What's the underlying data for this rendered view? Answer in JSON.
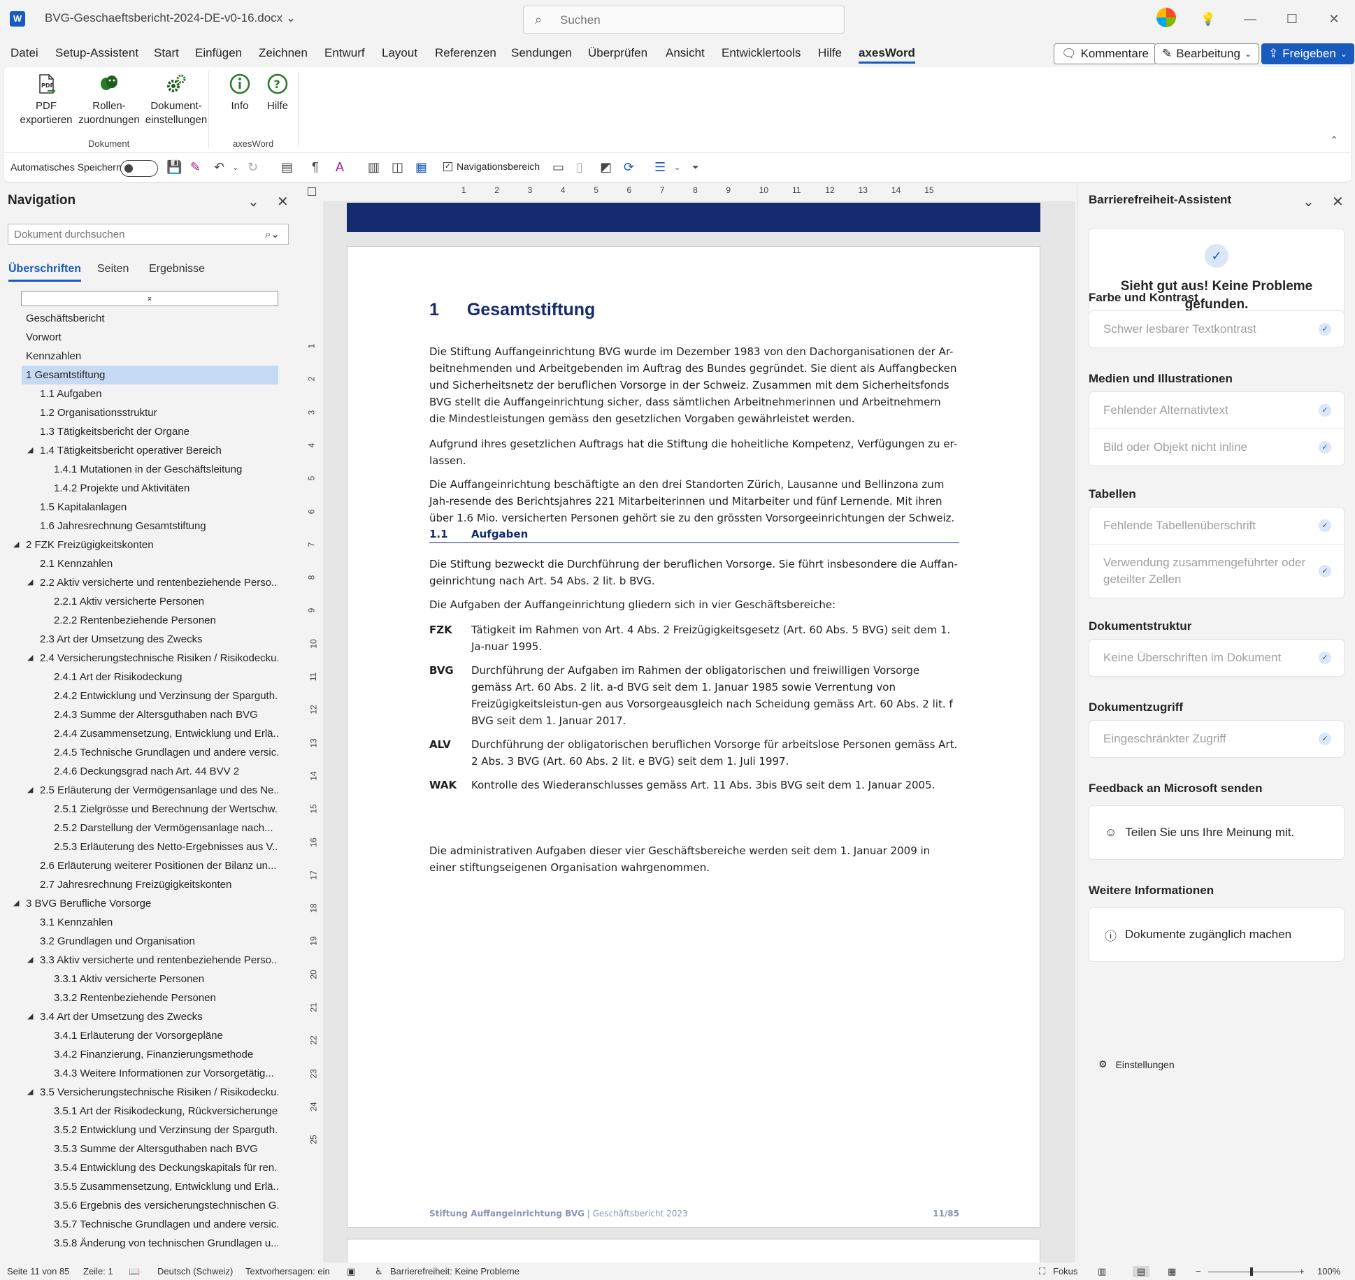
{
  "titlebar": {
    "doc_title": "BVG-Geschaeftsbericht-2024-DE-v0-16.docx",
    "title_chevron": "⌄",
    "search_placeholder": "Suchen",
    "app_icon_letter": "W"
  },
  "menu": {
    "items": [
      "Datei",
      "Setup-Assistent",
      "Start",
      "Einfügen",
      "Zeichnen",
      "Entwurf",
      "Layout",
      "Referenzen",
      "Sendungen",
      "Überprüfen",
      "Ansicht",
      "Entwicklertools",
      "Hilfe",
      "axesWord"
    ],
    "active": "axesWord",
    "comments_label": "Kommentare",
    "editing_label": "Bearbeitung",
    "share_label": "Freigeben"
  },
  "ribbon": {
    "group_document": "Dokument",
    "group_axesword": "axesWord",
    "pdf_line1": "PDF",
    "pdf_line2": "exportieren",
    "roles_line1": "Rollen-",
    "roles_line2": "zuordnungen",
    "docsettings_line1": "Dokument-",
    "docsettings_line2": "einstellungen",
    "info": "Info",
    "help": "Hilfe"
  },
  "qat": {
    "autosave_label": "Automatisches Speichern",
    "nav_pane_label": "Navigationsbereich"
  },
  "navigation": {
    "title": "Navigation",
    "search_placeholder": "Dokument durchsuchen",
    "tabs": [
      "Überschriften",
      "Seiten",
      "Ergebnisse"
    ],
    "active_tab": "Überschriften",
    "items": [
      {
        "level": 0,
        "text": "Geschäftsbericht",
        "expander": false
      },
      {
        "level": 0,
        "text": "Vorwort",
        "expander": false
      },
      {
        "level": 0,
        "text": "Kennzahlen",
        "expander": false
      },
      {
        "level": 0,
        "text": "1 Gesamtstiftung",
        "expander": true,
        "selected": true
      },
      {
        "level": 1,
        "text": "1.1 Aufgaben",
        "expander": false
      },
      {
        "level": 1,
        "text": "1.2 Organisationsstruktur",
        "expander": false
      },
      {
        "level": 1,
        "text": "1.3 Tätigkeitsbericht der Organe",
        "expander": false
      },
      {
        "level": 1,
        "text": "1.4 Tätigkeitsbericht operativer Bereich",
        "expander": true
      },
      {
        "level": 2,
        "text": "1.4.1 Mutationen in der Geschäftsleitung",
        "expander": false
      },
      {
        "level": 2,
        "text": "1.4.2 Projekte und Aktivitäten",
        "expander": false
      },
      {
        "level": 1,
        "text": "1.5 Kapitalanlagen",
        "expander": false
      },
      {
        "level": 1,
        "text": "1.6 Jahresrechnung Gesamtstiftung",
        "expander": false
      },
      {
        "level": 0,
        "text": "2 FZK Freizügigkeitskonten",
        "expander": true
      },
      {
        "level": 1,
        "text": "2.1 Kennzahlen",
        "expander": false
      },
      {
        "level": 1,
        "text": "2.2 Aktiv versicherte und rentenbeziehende Perso...",
        "expander": true
      },
      {
        "level": 2,
        "text": "2.2.1 Aktiv versicherte Personen",
        "expander": false
      },
      {
        "level": 2,
        "text": "2.2.2 Rentenbeziehende Personen",
        "expander": false
      },
      {
        "level": 1,
        "text": "2.3 Art der Umsetzung des Zwecks",
        "expander": false
      },
      {
        "level": 1,
        "text": "2.4 Versicherungstechnische Risiken / Risikodecku...",
        "expander": true
      },
      {
        "level": 2,
        "text": "2.4.1 Art der Risikodeckung",
        "expander": false
      },
      {
        "level": 2,
        "text": "2.4.2 Entwicklung und Verzinsung der Sparguth...",
        "expander": false
      },
      {
        "level": 2,
        "text": "2.4.3 Summe der Altersguthaben nach BVG",
        "expander": false
      },
      {
        "level": 2,
        "text": "2.4.4 Zusammensetzung, Entwicklung und Erlä...",
        "expander": false
      },
      {
        "level": 2,
        "text": "2.4.5 Technische Grundlagen und andere versic...",
        "expander": false
      },
      {
        "level": 2,
        "text": "2.4.6 Deckungsgrad nach Art. 44 BVV 2",
        "expander": false
      },
      {
        "level": 1,
        "text": "2.5 Erläuterung der Vermögensanlage und des Ne...",
        "expander": true
      },
      {
        "level": 2,
        "text": "2.5.1 Zielgrösse und Berechnung der Wertschw...",
        "expander": false
      },
      {
        "level": 2,
        "text": "2.5.2 Darstellung der Vermögensanlage nach...",
        "expander": false
      },
      {
        "level": 2,
        "text": "2.5.3 Erläuterung des Netto-Ergebnisses aus V...",
        "expander": false
      },
      {
        "level": 1,
        "text": "2.6 Erläuterung weiterer Positionen der Bilanz un...",
        "expander": false
      },
      {
        "level": 1,
        "text": "2.7 Jahresrechnung Freizügigkeitskonten",
        "expander": false
      },
      {
        "level": 0,
        "text": "3 BVG Berufliche Vorsorge",
        "expander": true
      },
      {
        "level": 1,
        "text": "3.1 Kennzahlen",
        "expander": false
      },
      {
        "level": 1,
        "text": "3.2 Grundlagen und Organisation",
        "expander": false
      },
      {
        "level": 1,
        "text": "3.3 Aktiv versicherte und rentenbeziehende Perso...",
        "expander": true
      },
      {
        "level": 2,
        "text": "3.3.1 Aktiv versicherte Personen",
        "expander": false
      },
      {
        "level": 2,
        "text": "3.3.2 Rentenbeziehende Personen",
        "expander": false
      },
      {
        "level": 1,
        "text": "3.4 Art der Umsetzung des Zwecks",
        "expander": true
      },
      {
        "level": 2,
        "text": "3.4.1 Erläuterung der Vorsorgepläne",
        "expander": false
      },
      {
        "level": 2,
        "text": "3.4.2 Finanzierung, Finanzierungsmethode",
        "expander": false
      },
      {
        "level": 2,
        "text": "3.4.3 Weitere Informationen zur Vorsorgetätig...",
        "expander": false
      },
      {
        "level": 1,
        "text": "3.5 Versicherungstechnische Risiken / Risikodecku...",
        "expander": true
      },
      {
        "level": 2,
        "text": "3.5.1 Art der Risikodeckung, Rückversicherungen",
        "expander": false
      },
      {
        "level": 2,
        "text": "3.5.2 Entwicklung und Verzinsung der Sparguth...",
        "expander": false
      },
      {
        "level": 2,
        "text": "3.5.3 Summe der Altersguthaben nach BVG",
        "expander": false
      },
      {
        "level": 2,
        "text": "3.5.4 Entwicklung des Deckungskapitals für ren...",
        "expander": false
      },
      {
        "level": 2,
        "text": "3.5.5 Zusammensetzung, Entwicklung und Erlä...",
        "expander": false
      },
      {
        "level": 2,
        "text": "3.5.6 Ergebnis des versicherungstechnischen G...",
        "expander": false
      },
      {
        "level": 2,
        "text": "3.5.7 Technische Grundlagen und andere versic...",
        "expander": false
      },
      {
        "level": 2,
        "text": "3.5.8 Änderung von technischen Grundlagen u...",
        "expander": false
      }
    ]
  },
  "ruler": {
    "h_marks": [
      "1",
      "2",
      "3",
      "4",
      "5",
      "6",
      "7",
      "8",
      "9",
      "10",
      "11",
      "12",
      "13",
      "14",
      "15"
    ],
    "v_marks": [
      "1",
      "2",
      "3",
      "4",
      "5",
      "6",
      "7",
      "8",
      "9",
      "10",
      "11",
      "12",
      "13",
      "14",
      "15",
      "16",
      "17",
      "18",
      "19",
      "20",
      "21",
      "22",
      "23",
      "24",
      "25"
    ]
  },
  "document": {
    "h1_num": "1",
    "h1_text": "Gesamtstiftung",
    "p1": "Die Stiftung Auffangeinrichtung BVG wurde im Dezember 1983 von den Dachorganisationen der Ar-beitnehmenden und Arbeitgebenden im Auftrag des Bundes gegründet. Sie dient als Auffangbecken und Sicherheitsnetz der beruflichen Vorsorge in der Schweiz. Zusammen mit dem Sicherheitsfonds BVG stellt die Auffangeinrichtung sicher, dass sämtlichen Arbeitnehmerinnen und Arbeitnehmern die Mindestleistungen gemäss den gesetzlichen Vorgaben gewährleistet werden.",
    "p2": "Aufgrund ihres gesetzlichen Auftrags hat die Stiftung die hoheitliche Kompetenz, Verfügungen zu er-lassen.",
    "p3": "Die Auffangeinrichtung beschäftigte an den drei Standorten Zürich, Lausanne und Bellinzona zum Jah-resende des Berichtsjahres 221 Mitarbeiterinnen und Mitarbeiter und fünf Lernende. Mit ihren über 1.6 Mio. versicherten Personen gehört sie zu den grössten Vorsorgeeinrichtungen der Schweiz.",
    "h2_num": "1.1",
    "h2_text": "Aufgaben",
    "p4": "Die Stiftung bezweckt die Durchführung der beruflichen Vorsorge. Sie führt insbesondere die Auffan-geinrichtung nach Art. 54 Abs. 2 lit. b BVG.",
    "p5": "Die Aufgaben der Auffangeinrichtung gliedern sich in vier Geschäftsbereiche:",
    "defs": [
      {
        "key": "FZK",
        "text": "Tätigkeit im Rahmen von Art. 4 Abs. 2 Freizügigkeitsgesetz (Art. 60 Abs. 5 BVG) seit dem 1. Ja-nuar 1995."
      },
      {
        "key": "BVG",
        "text": "Durchführung der Aufgaben im Rahmen der obligatorischen und freiwilligen Vorsorge gemäss Art. 60 Abs. 2 lit. a-d BVG seit dem 1. Januar 1985 sowie Verrentung von Freizügigkeitsleistun-gen aus Vorsorgeausgleich nach Scheidung gemäss Art. 60 Abs. 2 lit. f BVG seit dem 1. Januar 2017."
      },
      {
        "key": "ALV",
        "text": "Durchführung der obligatorischen beruflichen Vorsorge für arbeitslose Personen gemäss Art. 2 Abs. 3 BVG (Art. 60 Abs. 2 lit. e BVG) seit dem 1. Juli 1997."
      },
      {
        "key": "WAK",
        "text": "Kontrolle des Wiederanschlusses gemäss Art. 11 Abs. 3bis BVG seit dem 1. Januar 2005."
      }
    ],
    "p6": "Die administrativen Aufgaben dieser vier Geschäftsbereiche werden seit dem 1. Januar 2009 in einer stiftungseigenen Organisation wahrgenommen.",
    "footer_org": "Stiftung Auffangeinrichtung BVG",
    "footer_sep": " | ",
    "footer_report": "Geschäftsbericht 2023",
    "footer_page": "11/85"
  },
  "accessibility": {
    "title": "Barrierefreiheit-Assistent",
    "ok_message": "Sieht gut aus! Keine Probleme gefunden.",
    "sections": [
      {
        "title": "Farbe und Kontrast",
        "items": [
          "Schwer lesbarer Textkontrast"
        ]
      },
      {
        "title": "Medien und Illustrationen",
        "items": [
          "Fehlender Alternativtext",
          "Bild oder Objekt nicht inline"
        ]
      },
      {
        "title": "Tabellen",
        "items": [
          "Fehlende Tabellenüberschrift",
          "Verwendung zusammengeführter oder geteilter Zellen"
        ]
      },
      {
        "title": "Dokumentstruktur",
        "items": [
          "Keine Überschriften im Dokument"
        ]
      },
      {
        "title": "Dokumentzugriff",
        "items": [
          "Eingeschränkter Zugriff"
        ]
      }
    ],
    "feedback_title": "Feedback an Microsoft senden",
    "feedback_link": "Teilen Sie uns Ihre Meinung mit.",
    "more_info_title": "Weitere Informationen",
    "more_info_link": "Dokumente zugänglich machen",
    "settings_label": "Einstellungen"
  },
  "statusbar": {
    "page": "Seite 11 von 85",
    "line": "Zeile: 1",
    "language": "Deutsch (Schweiz)",
    "predictions": "Textvorhersagen: ein",
    "accessibility": "Barrierefreiheit: Keine Probleme",
    "focus": "Fokus",
    "zoom": "100%",
    "zoom_value": 100
  }
}
